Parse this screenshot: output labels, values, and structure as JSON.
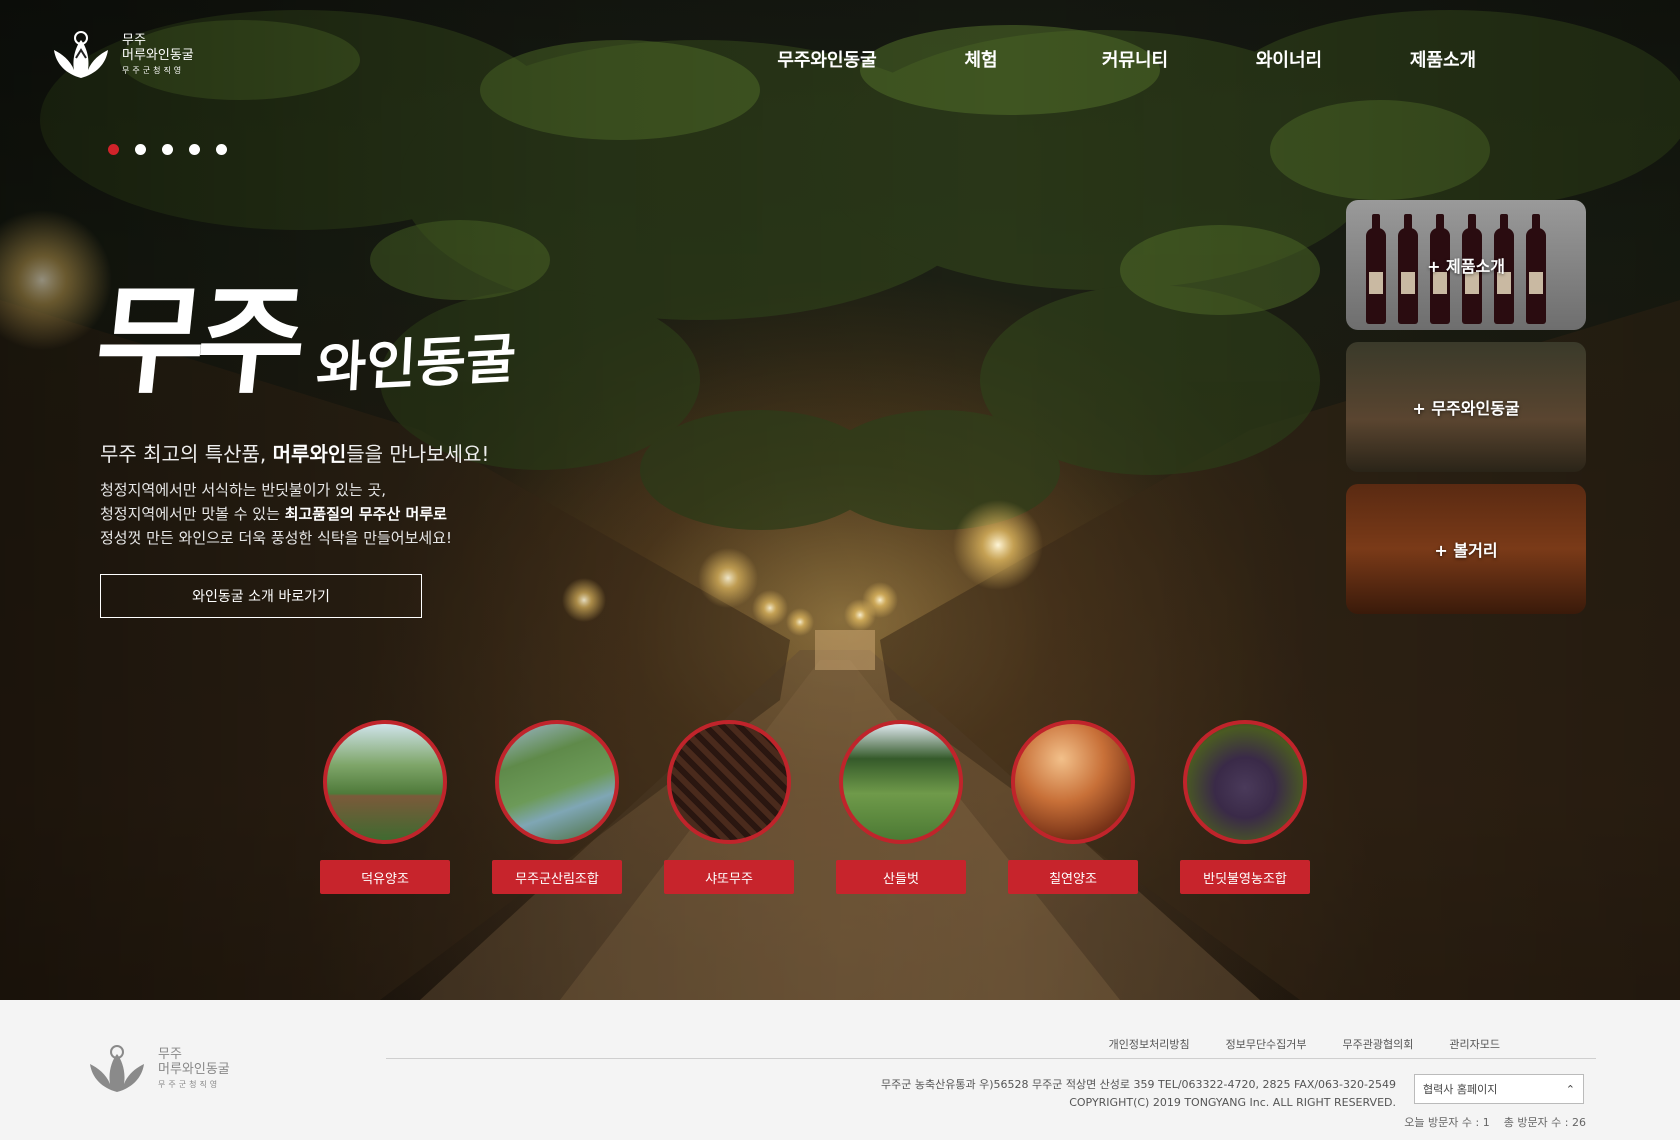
{
  "header": {
    "logo_line1": "무주",
    "logo_line2": "머루와인동굴",
    "logo_line3": "무주군청직영",
    "nav": [
      "무주와인동굴",
      "체험",
      "커뮤니티",
      "와이너리",
      "제품소개"
    ]
  },
  "slider": {
    "count": 5,
    "active_index": 0
  },
  "hero": {
    "title_main": "무주",
    "title_sub": "와인동굴",
    "lead_prefix": "무주 최고의 특산품, ",
    "lead_bold": "머루와인",
    "lead_suffix": "들을 만나보세요!",
    "desc_line1": "청정지역에서만 서식하는 반딧불이가 있는 곳,",
    "desc_line2_prefix": "청정지역에서만 맛볼 수 있는 ",
    "desc_line2_bold": "최고품질의 무주산 머루로",
    "desc_line3": "정성껏 만든 와인으로 더욱 풍성한 식탁을 만들어보세요!",
    "cta_label": "와인동굴 소개 바로가기"
  },
  "side_cards": [
    {
      "label": "+ 제품소개"
    },
    {
      "label": "+ 무주와인동굴"
    },
    {
      "label": "+ 볼거리"
    }
  ],
  "partners": [
    {
      "label": "덕유양조"
    },
    {
      "label": "무주군산림조합"
    },
    {
      "label": "샤또무주"
    },
    {
      "label": "산들벗"
    },
    {
      "label": "칠연양조"
    },
    {
      "label": "반딧불영농조합"
    }
  ],
  "footer": {
    "logo_line1": "무주",
    "logo_line2": "머루와인동굴",
    "logo_line3": "무주군청직영",
    "links": [
      "개인정보처리방침",
      "정보무단수집거부",
      "무주관광협의회",
      "관리자모드"
    ],
    "address": "무주군 농축산유통과 우)56528 무주군 적상면 산성로 359 TEL/063322-4720, 2825 FAX/063-320-2549",
    "copyright": "COPYRIGHT(C) 2019 TONGYANG Inc. ALL RIGHT RESERVED.",
    "select_label": "협력사 홈페이지",
    "visit_today": "오늘 방문자 수 : 1",
    "visit_total": "총 방문자 수 : 26"
  },
  "colors": {
    "accent": "#c7242c",
    "active_dot": "#d1232a",
    "footer_bg": "#f4f4f4"
  }
}
